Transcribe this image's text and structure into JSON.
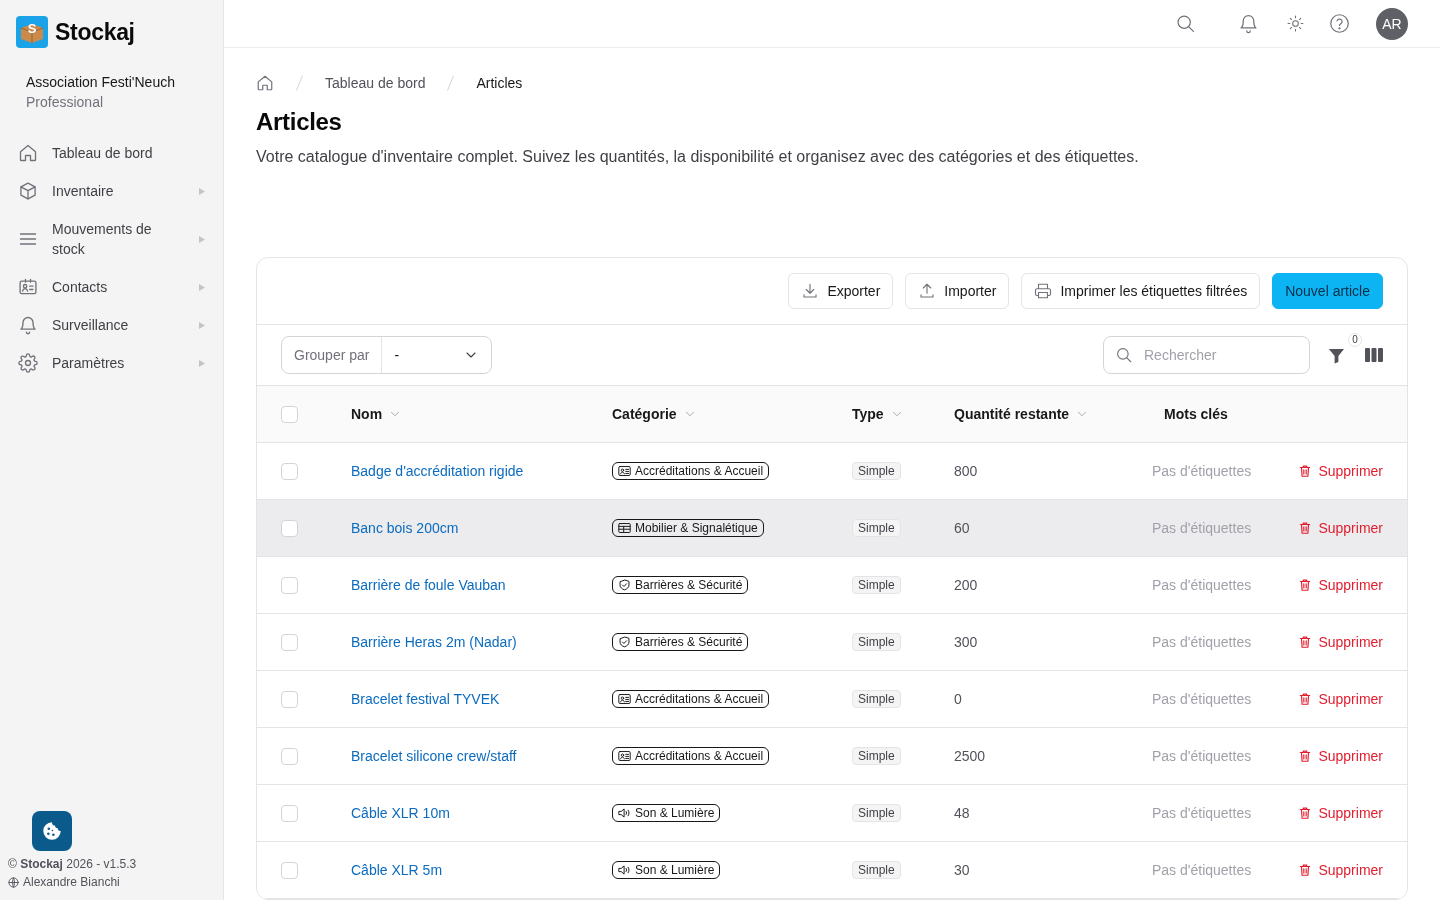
{
  "sidebar": {
    "logo": {
      "mark": "S",
      "name": "Stockaj"
    },
    "organization": {
      "name": "Association Festi'Neuch",
      "plan": "Professional"
    },
    "items": [
      {
        "kind": "home",
        "label": "Tableau de bord",
        "submenu": false
      },
      {
        "kind": "inventory",
        "label": "Inventaire",
        "submenu": true
      },
      {
        "kind": "movements",
        "label": "Mouvements de stock",
        "submenu": true
      },
      {
        "kind": "contacts",
        "label": "Contacts",
        "submenu": true
      },
      {
        "kind": "monitoring",
        "label": "Surveillance",
        "submenu": true
      },
      {
        "kind": "settings",
        "label": "Paramètres",
        "submenu": true
      }
    ],
    "footer": {
      "copyright": "© **Stockaj** 2026 - v1.5.3",
      "user": "Alexandre Bianchi"
    }
  },
  "top_bar": {
    "avatar": "AR"
  },
  "breadcrumb": [
    "Tableau de bord",
    "Articles"
  ],
  "page": {
    "title": "Articles",
    "description": "Votre catalogue d'inventaire complet. Suivez les quantités, la disponibilité et organisez avec des catégories et des étiquettes."
  },
  "toolbar": {
    "buttons": [
      {
        "kind": "export",
        "label": "Exporter"
      },
      {
        "kind": "import",
        "label": "Importer"
      },
      {
        "kind": "print",
        "label": "Imprimer les étiquettes filtrées"
      },
      {
        "kind": "primary",
        "label": "Nouvel article"
      }
    ]
  },
  "filters": {
    "group_by": {
      "label": "Grouper par",
      "value": "-"
    },
    "search": {
      "placeholder": "Rechercher"
    },
    "filter_count": "0"
  },
  "table": {
    "select_all": {
      "checked": false
    },
    "columns": [
      {
        "label": "Nom",
        "sortable": true
      },
      {
        "label": "Catégorie",
        "sortable": true
      },
      {
        "label": "Type",
        "sortable": true
      },
      {
        "label": "Quantité restante",
        "sortable": true
      },
      {
        "label": "Mots clés",
        "sortable": false
      }
    ],
    "rows": [
      {
        "checked": false,
        "hovered": false,
        "name": "Badge d'accréditation rigide",
        "category": {
          "kind": "accreditation",
          "label": "Accréditations & Accueil"
        },
        "type": "Simple",
        "quantity": "800",
        "tags": "Pas d'étiquettes",
        "action": "Supprimer"
      },
      {
        "checked": false,
        "hovered": true,
        "name": "Banc bois 200cm",
        "category": {
          "kind": "furniture",
          "label": "Mobilier & Signalétique"
        },
        "type": "Simple",
        "quantity": "60",
        "tags": "Pas d'étiquettes",
        "action": "Supprimer"
      },
      {
        "checked": false,
        "hovered": false,
        "name": "Barrière de foule Vauban",
        "category": {
          "kind": "barrier",
          "label": "Barrières & Sécurité"
        },
        "type": "Simple",
        "quantity": "200",
        "tags": "Pas d'étiquettes",
        "action": "Supprimer"
      },
      {
        "checked": false,
        "hovered": false,
        "name": "Barrière Heras 2m (Nadar)",
        "category": {
          "kind": "barrier",
          "label": "Barrières & Sécurité"
        },
        "type": "Simple",
        "quantity": "300",
        "tags": "Pas d'étiquettes",
        "action": "Supprimer"
      },
      {
        "checked": false,
        "hovered": false,
        "name": "Bracelet festival TYVEK",
        "category": {
          "kind": "accreditation",
          "label": "Accréditations & Accueil"
        },
        "type": "Simple",
        "quantity": "0",
        "tags": "Pas d'étiquettes",
        "action": "Supprimer"
      },
      {
        "checked": false,
        "hovered": false,
        "name": "Bracelet silicone crew/staff",
        "category": {
          "kind": "accreditation",
          "label": "Accréditations & Accueil"
        },
        "type": "Simple",
        "quantity": "2500",
        "tags": "Pas d'étiquettes",
        "action": "Supprimer"
      },
      {
        "checked": false,
        "hovered": false,
        "name": "Câble XLR 10m",
        "category": {
          "kind": "sound",
          "label": "Son & Lumière"
        },
        "type": "Simple",
        "quantity": "48",
        "tags": "Pas d'étiquettes",
        "action": "Supprimer"
      },
      {
        "checked": false,
        "hovered": false,
        "name": "Câble XLR 5m",
        "category": {
          "kind": "sound",
          "label": "Son & Lumière"
        },
        "type": "Simple",
        "quantity": "30",
        "tags": "Pas d'étiquettes",
        "action": "Supprimer"
      }
    ]
  }
}
